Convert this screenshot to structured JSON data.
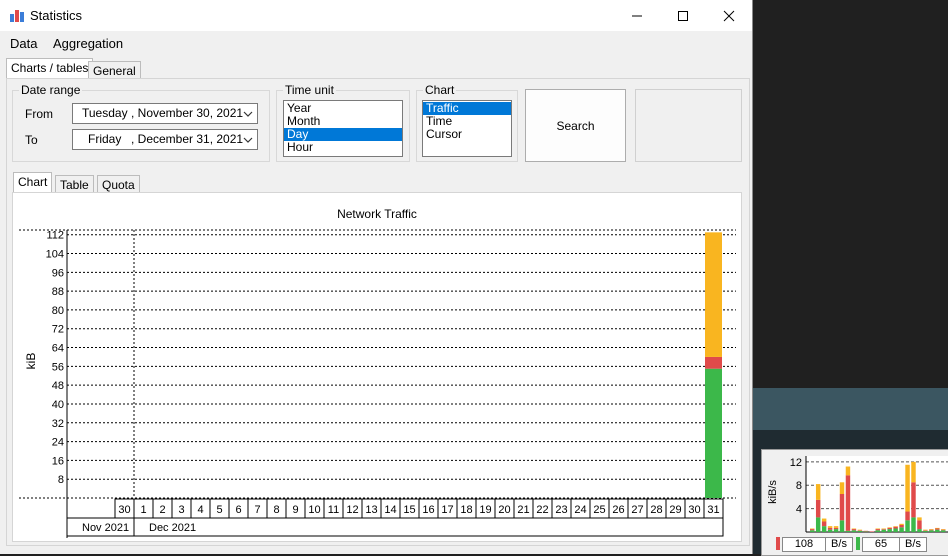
{
  "window": {
    "title": "Statistics"
  },
  "menu": [
    "Data",
    "Aggregation"
  ],
  "tabs_top": [
    "Charts / tables",
    "General"
  ],
  "date_range": {
    "label": "Date range",
    "from_label": "From",
    "to_label": "To",
    "from_weekday": "Tuesday",
    "from_date": ", November 30, 2021",
    "to_weekday": "Friday",
    "to_date": ", December 31, 2021"
  },
  "time_unit": {
    "label": "Time unit",
    "options": [
      "Year",
      "Month",
      "Day",
      "Hour"
    ],
    "selected": "Day"
  },
  "chart_select": {
    "label": "Chart",
    "options": [
      "Traffic",
      "Time",
      "Cursor"
    ],
    "selected": "Traffic"
  },
  "search_button": "Search",
  "tabs_inner": [
    "Chart",
    "Table",
    "Quota"
  ],
  "colors": {
    "yellow": "#f9b520",
    "red": "#e04a4a",
    "green": "#3cb84a",
    "selection": "#0078d7"
  },
  "chart_data": {
    "type": "bar",
    "title": "Network Traffic",
    "ylabel": "kiB",
    "ylim": [
      0,
      114
    ],
    "yticks": [
      8,
      16,
      24,
      32,
      40,
      48,
      56,
      64,
      72,
      80,
      88,
      96,
      104,
      112
    ],
    "categories": [
      "30",
      "1",
      "2",
      "3",
      "4",
      "5",
      "6",
      "7",
      "8",
      "9",
      "10",
      "11",
      "12",
      "13",
      "14",
      "15",
      "16",
      "17",
      "18",
      "19",
      "20",
      "21",
      "22",
      "23",
      "24",
      "25",
      "26",
      "27",
      "28",
      "29",
      "30",
      "31"
    ],
    "month_labels": [
      {
        "label": "Nov 2021",
        "start": 0,
        "span": 1
      },
      {
        "label": "Dec 2021",
        "start": 1,
        "span": 31
      }
    ],
    "series": [
      {
        "color": "#3cb84a",
        "values": [
          0,
          0,
          0,
          0,
          0,
          0,
          0,
          0,
          0,
          0,
          0,
          0,
          0,
          0,
          0,
          0,
          0,
          0,
          0,
          0,
          0,
          0,
          0,
          0,
          0,
          0,
          0,
          0,
          0,
          0,
          0,
          55
        ]
      },
      {
        "color": "#e04a4a",
        "values": [
          0,
          0,
          0,
          0,
          0,
          0,
          0,
          0,
          0,
          0,
          0,
          0,
          0,
          0,
          0,
          0,
          0,
          0,
          0,
          0,
          0,
          0,
          0,
          0,
          0,
          0,
          0,
          0,
          0,
          0,
          0,
          5
        ]
      },
      {
        "color": "#f9b520",
        "values": [
          0,
          0,
          0,
          0,
          0,
          0,
          0,
          0,
          0,
          0,
          0,
          0,
          0,
          0,
          0,
          0,
          0,
          0,
          0,
          0,
          0,
          0,
          0,
          0,
          0,
          0,
          0,
          0,
          0,
          0,
          0,
          53
        ]
      }
    ]
  },
  "mini_chart": {
    "ylabel": "kiB/s",
    "yticks": [
      4,
      8,
      12
    ],
    "rx_value": "108",
    "rx_unit": "B/s",
    "tx_value": "65",
    "tx_unit": "B/s",
    "chart_data": {
      "type": "bar",
      "ylabel": "kiB/s",
      "ylim": [
        0,
        13
      ],
      "series": [
        {
          "color": "#3cb84a",
          "values": [
            0.3,
            2.5,
            1.0,
            0.4,
            0.5,
            2.0,
            0.2,
            0.3,
            0.2,
            0.1,
            0,
            0.3,
            0.4,
            0.5,
            0.6,
            0.8,
            2.0,
            2.5,
            0.5,
            0.2,
            0.3,
            0.4,
            0.3
          ]
        },
        {
          "color": "#e04a4a",
          "values": [
            0.2,
            3.0,
            0.8,
            0.3,
            0.2,
            4.5,
            9.5,
            0.2,
            0.1,
            0.1,
            0.1,
            0.2,
            0.1,
            0.2,
            0.3,
            0.4,
            1.5,
            6.0,
            1.5,
            0.1,
            0.1,
            0.2,
            0.1
          ]
        },
        {
          "color": "#f9b520",
          "values": [
            0.1,
            2.7,
            0.5,
            0.3,
            0.3,
            2.0,
            1.5,
            0.1,
            0.1,
            0,
            0,
            0.1,
            0.1,
            0.1,
            0.1,
            0.2,
            8.0,
            3.5,
            0.5,
            0.1,
            0.1,
            0.1,
            0.1
          ]
        }
      ]
    }
  }
}
